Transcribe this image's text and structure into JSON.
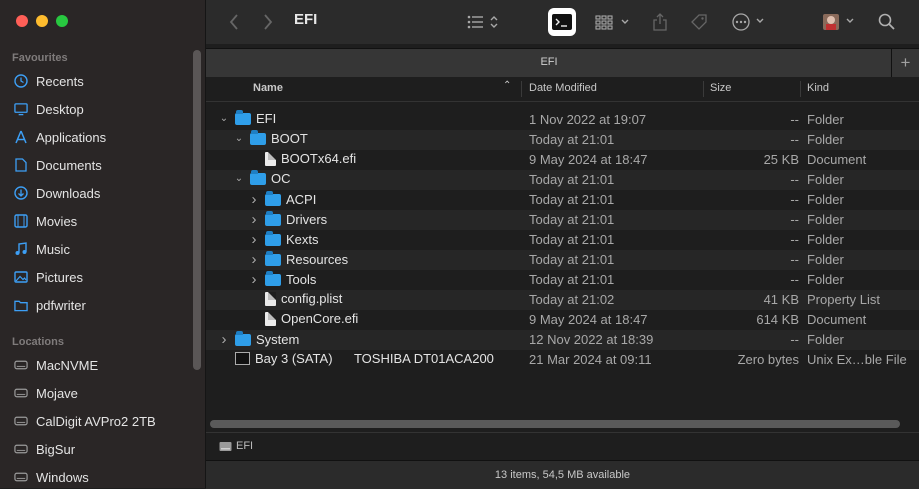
{
  "window": {
    "title": "EFI",
    "tab_title": "EFI",
    "status": "13 items, 54,5 MB available",
    "path_label": "EFI"
  },
  "colors": {
    "accent": "#2f9ee9",
    "sidebar_bg": "#2a2626",
    "content_bg": "#1e1e1e"
  },
  "sidebar": {
    "favourites_label": "Favourites",
    "favourites": [
      {
        "label": "Recents",
        "icon": "clock-icon"
      },
      {
        "label": "Desktop",
        "icon": "desktop-icon"
      },
      {
        "label": "Applications",
        "icon": "applications-icon"
      },
      {
        "label": "Documents",
        "icon": "document-icon"
      },
      {
        "label": "Downloads",
        "icon": "download-icon"
      },
      {
        "label": "Movies",
        "icon": "film-icon"
      },
      {
        "label": "Music",
        "icon": "music-icon"
      },
      {
        "label": "Pictures",
        "icon": "photo-icon"
      },
      {
        "label": "pdfwriter",
        "icon": "folder-icon"
      }
    ],
    "locations_label": "Locations",
    "locations": [
      {
        "label": "MacNVME",
        "icon": "drive-icon"
      },
      {
        "label": "Mojave",
        "icon": "drive-icon"
      },
      {
        "label": "CalDigit AVPro2 2TB",
        "icon": "drive-icon"
      },
      {
        "label": "BigSur",
        "icon": "drive-icon"
      },
      {
        "label": "Windows",
        "icon": "drive-icon"
      }
    ]
  },
  "toolbar": {
    "back_icon": "chevron-left-icon",
    "forward_icon": "chevron-right-icon",
    "view_icon": "list-view-icon",
    "terminal_icon": "terminal-icon",
    "group_icon": "grid-icon",
    "share_icon": "share-icon",
    "tag_icon": "tag-icon",
    "more_icon": "ellipsis-icon",
    "avatar_icon": "avatar-icon",
    "search_icon": "search-icon"
  },
  "columns": {
    "name": "Name",
    "date": "Date Modified",
    "size": "Size",
    "kind": "Kind"
  },
  "files": [
    {
      "name": "EFI",
      "date": "1 Nov 2022 at 19:07",
      "size": "--",
      "kind": "Folder",
      "type": "folder",
      "level": 0,
      "expand": "open"
    },
    {
      "name": "BOOT",
      "date": "Today at 21:01",
      "size": "--",
      "kind": "Folder",
      "type": "folder",
      "level": 1,
      "expand": "open"
    },
    {
      "name": "BOOTx64.efi",
      "date": "9 May 2024 at 18:47",
      "size": "25 KB",
      "kind": "Document",
      "type": "doc",
      "level": 2,
      "expand": "none"
    },
    {
      "name": "OC",
      "date": "Today at 21:01",
      "size": "--",
      "kind": "Folder",
      "type": "folder",
      "level": 1,
      "expand": "open"
    },
    {
      "name": "ACPI",
      "date": "Today at 21:01",
      "size": "--",
      "kind": "Folder",
      "type": "folder",
      "level": 2,
      "expand": "closed"
    },
    {
      "name": "Drivers",
      "date": "Today at 21:01",
      "size": "--",
      "kind": "Folder",
      "type": "folder",
      "level": 2,
      "expand": "closed"
    },
    {
      "name": "Kexts",
      "date": "Today at 21:01",
      "size": "--",
      "kind": "Folder",
      "type": "folder",
      "level": 2,
      "expand": "closed"
    },
    {
      "name": "Resources",
      "date": "Today at 21:01",
      "size": "--",
      "kind": "Folder",
      "type": "folder",
      "level": 2,
      "expand": "closed"
    },
    {
      "name": "Tools",
      "date": "Today at 21:01",
      "size": "--",
      "kind": "Folder",
      "type": "folder",
      "level": 2,
      "expand": "closed"
    },
    {
      "name": "config.plist",
      "date": "Today at 21:02",
      "size": "41 KB",
      "kind": "Property List",
      "type": "doc",
      "level": 2,
      "expand": "none"
    },
    {
      "name": "OpenCore.efi",
      "date": "9 May 2024 at 18:47",
      "size": "614 KB",
      "kind": "Document",
      "type": "doc",
      "level": 2,
      "expand": "none"
    },
    {
      "name": "System",
      "date": "12 Nov 2022 at 18:39",
      "size": "--",
      "kind": "Folder",
      "type": "folder",
      "level": 0,
      "expand": "closed"
    },
    {
      "name": "Bay 3 (SATA)      TOSHIBA DT01ACA200",
      "date": "21 Mar 2024 at 09:11",
      "size": "Zero bytes",
      "kind": "Unix Ex…ble File",
      "type": "exe",
      "level": 0,
      "expand": "none"
    }
  ]
}
